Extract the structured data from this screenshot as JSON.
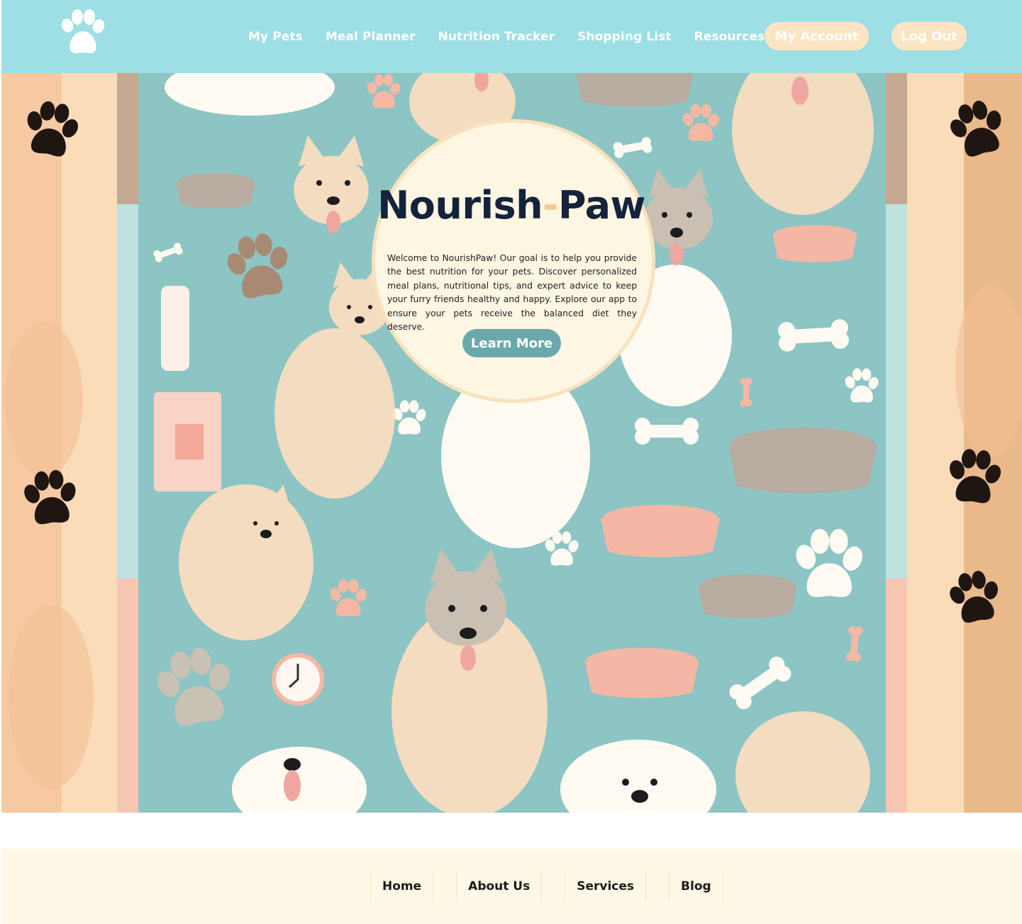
{
  "header": {
    "logo_icon": "paw-icon",
    "nav": [
      "My Pets",
      "Meal Planner",
      "Nutrition Tracker",
      "Shopping List",
      "Resources"
    ],
    "account_label": "My Account",
    "logout_label": "Log Out"
  },
  "hero": {
    "title_part1": "Nourish",
    "title_dash": "-",
    "title_part2": "Paw",
    "intro": "Welcome to NourishPaw! Our goal is to help you provide the best nutrition for your pets. Discover personalized meal plans, nutritional tips, and expert advice to keep your furry friends healthy and happy. Explore our app to ensure your pets receive the balanced diet they deserve.",
    "cta_label": "Learn More",
    "background": "illustrated pattern of dogs, food bowls, bones and paw prints"
  },
  "footer": {
    "nav": [
      "Home",
      "About Us",
      "Services",
      "Blog"
    ]
  },
  "colors": {
    "header_bg": "#9ddfe4",
    "pill_bg": "#fde5c4",
    "cta_bg": "#6aa8ae",
    "circle_bg": "#fdf6e3",
    "title": "#14233b",
    "panel_teal": "#8cc5c3",
    "footer_bg": "#fff8e6"
  }
}
